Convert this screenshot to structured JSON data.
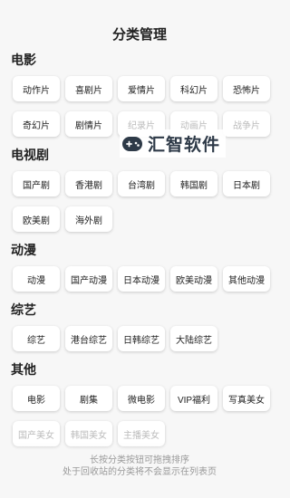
{
  "header": {
    "title": "分类管理"
  },
  "watermark": {
    "text": "汇智软件"
  },
  "sections": [
    {
      "title": "电影",
      "items": [
        {
          "label": "动作片"
        },
        {
          "label": "喜剧片"
        },
        {
          "label": "爱情片"
        },
        {
          "label": "科幻片"
        },
        {
          "label": "恐怖片"
        },
        {
          "label": "奇幻片"
        },
        {
          "label": "剧情片"
        },
        {
          "label": "纪录片",
          "faded": true
        },
        {
          "label": "动画片",
          "faded": true
        },
        {
          "label": "战争片",
          "faded": true
        }
      ]
    },
    {
      "title": "电视剧",
      "items": [
        {
          "label": "国产剧"
        },
        {
          "label": "香港剧"
        },
        {
          "label": "台湾剧"
        },
        {
          "label": "韩国剧"
        },
        {
          "label": "日本剧"
        },
        {
          "label": "欧美剧"
        },
        {
          "label": "海外剧"
        }
      ]
    },
    {
      "title": "动漫",
      "items": [
        {
          "label": "动漫"
        },
        {
          "label": "国产动漫"
        },
        {
          "label": "日本动漫"
        },
        {
          "label": "欧美动漫"
        },
        {
          "label": "其他动漫"
        }
      ]
    },
    {
      "title": "综艺",
      "items": [
        {
          "label": "综艺"
        },
        {
          "label": "港台综艺"
        },
        {
          "label": "日韩综艺"
        },
        {
          "label": "大陆综艺"
        }
      ]
    },
    {
      "title": "其他",
      "items": [
        {
          "label": "电影"
        },
        {
          "label": "剧集"
        },
        {
          "label": "微电影"
        },
        {
          "label": "VIP福利"
        },
        {
          "label": "写真美女"
        },
        {
          "label": "国产美女",
          "faded": true
        },
        {
          "label": "韩国美女",
          "faded": true
        },
        {
          "label": "主播美女",
          "faded": true
        }
      ]
    }
  ],
  "footer": {
    "line1": "长按分类按钮可拖拽排序",
    "line2": "处于回收站的分类将不会显示在列表页"
  }
}
